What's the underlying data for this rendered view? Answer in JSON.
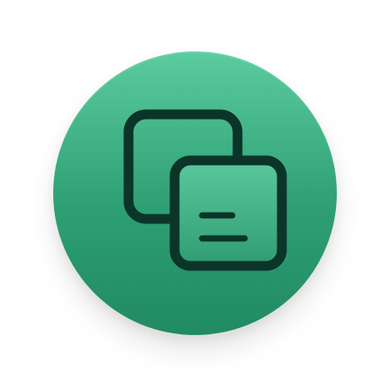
{
  "icon": {
    "name": "copy-note-icon",
    "colors": {
      "background_top": "#5acc9f",
      "background_bottom": "#218a62",
      "stroke": "#0b3529"
    }
  }
}
